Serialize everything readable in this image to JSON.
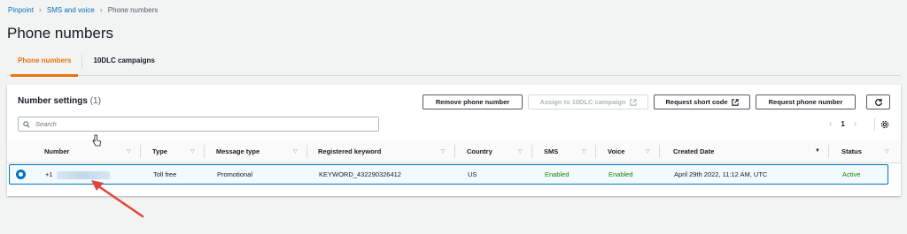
{
  "breadcrumb": [
    "Pinpoint",
    "SMS and voice",
    "Phone numbers"
  ],
  "page_title": "Phone numbers",
  "tabs": [
    {
      "label": "Phone numbers",
      "active": true
    },
    {
      "label": "10DLC campaigns",
      "active": false
    }
  ],
  "panel": {
    "title": "Number settings",
    "count": "(1)",
    "buttons": {
      "remove": "Remove phone number",
      "assign": "Assign to 10DLC campaign",
      "short_code": "Request short code",
      "request": "Request phone number"
    },
    "search_placeholder": "Search",
    "page": "1"
  },
  "columns": [
    "Number",
    "Type",
    "Message type",
    "Registered keyword",
    "Country",
    "SMS",
    "Voice",
    "Created Date",
    "Status"
  ],
  "row": {
    "number": "+1",
    "type": "Toll free",
    "message_type": "Promotional",
    "keyword": "KEYWORD_432290326412",
    "country": "US",
    "sms": "Enabled",
    "voice": "Enabled",
    "created": "April 29th 2022, 11:12 AM, UTC",
    "status": "Active"
  },
  "colors": {
    "accent": "#ec7211",
    "link": "#0073bb",
    "success": "#1d8102",
    "annotation": "#e0453a"
  },
  "icons": [
    "chevron-right-icon",
    "search-icon",
    "external-link-icon",
    "refresh-icon",
    "gear-icon",
    "sort-icon",
    "cursor-icon",
    "annotation-arrow-icon"
  ]
}
